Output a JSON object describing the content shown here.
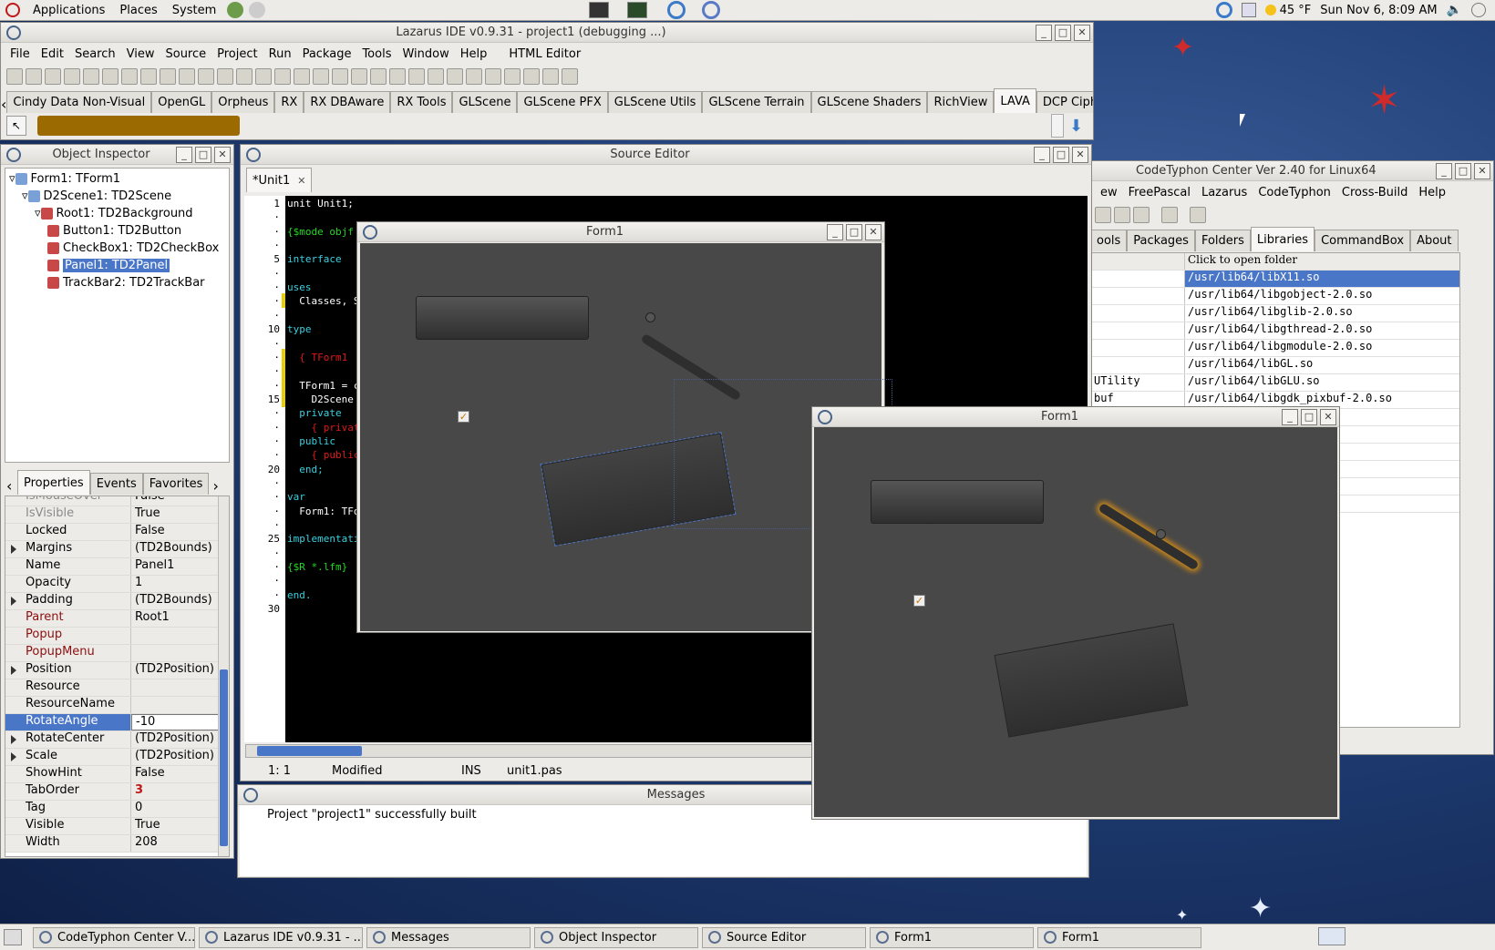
{
  "top_panel": {
    "menus": [
      "Applications",
      "Places",
      "System"
    ],
    "weather": "45 °F",
    "clock": "Sun Nov  6,  8:09 AM"
  },
  "lazarus": {
    "title": "Lazarus IDE v0.9.31 - project1 (debugging ...)",
    "menu": [
      "File",
      "Edit",
      "Search",
      "View",
      "Source",
      "Project",
      "Run",
      "Package",
      "Tools",
      "Window",
      "Help",
      "HTML Editor"
    ],
    "palette_tabs": [
      "Cindy Data Non-Visual",
      "OpenGL",
      "Orpheus",
      "RX",
      "RX DBAware",
      "RX Tools",
      "GLScene",
      "GLScene PFX",
      "GLScene Utils",
      "GLScene Terrain",
      "GLScene Shaders",
      "RichView",
      "LAVA",
      "DCP Ciphers"
    ],
    "active_palette_tab": "LAVA",
    "arch_badge": "64"
  },
  "object_inspector": {
    "title": "Object Inspector",
    "tree": [
      {
        "label": "Form1: TForm1",
        "level": 0
      },
      {
        "label": "D2Scene1: TD2Scene",
        "level": 1
      },
      {
        "label": "Root1: TD2Background",
        "level": 2
      },
      {
        "label": "Button1: TD2Button",
        "level": 3
      },
      {
        "label": "CheckBox1: TD2CheckBox",
        "level": 3
      },
      {
        "label": "Panel1: TD2Panel",
        "level": 3
      },
      {
        "label": "TrackBar2: TD2TrackBar",
        "level": 3
      }
    ],
    "selected_node": "Panel1: TD2Panel",
    "tabs": [
      "Properties",
      "Events",
      "Favorites"
    ],
    "properties": [
      {
        "name": "IsMouseOver",
        "value": "False"
      },
      {
        "name": "IsVisible",
        "value": "True"
      },
      {
        "name": "Locked",
        "value": "False"
      },
      {
        "name": "Margins",
        "value": "(TD2Bounds)"
      },
      {
        "name": "Name",
        "value": "Panel1"
      },
      {
        "name": "Opacity",
        "value": "1"
      },
      {
        "name": "Padding",
        "value": "(TD2Bounds)"
      },
      {
        "name": "Parent",
        "value": "Root1"
      },
      {
        "name": "Popup",
        "value": ""
      },
      {
        "name": "PopupMenu",
        "value": ""
      },
      {
        "name": "Position",
        "value": "(TD2Position)"
      },
      {
        "name": "Resource",
        "value": ""
      },
      {
        "name": "ResourceName",
        "value": ""
      },
      {
        "name": "RotateAngle",
        "value": "-10"
      },
      {
        "name": "RotateCenter",
        "value": "(TD2Position)"
      },
      {
        "name": "Scale",
        "value": "(TD2Position)"
      },
      {
        "name": "ShowHint",
        "value": "False"
      },
      {
        "name": "TabOrder",
        "value": "3"
      },
      {
        "name": "Tag",
        "value": "0"
      },
      {
        "name": "Visible",
        "value": "True"
      },
      {
        "name": "Width",
        "value": "208"
      }
    ]
  },
  "source_editor": {
    "title": "Source Editor",
    "tab": "*Unit1",
    "gutter": [
      "1",
      "·",
      "·",
      "·",
      "5",
      "·",
      "·",
      "·",
      "·",
      "10",
      "·",
      "·",
      "·",
      "·",
      "15",
      "·",
      "·",
      "·",
      "·",
      "20",
      "·",
      "·",
      "·",
      "·",
      "25",
      "·",
      "·",
      "·",
      "·",
      "30"
    ],
    "lines": [
      {
        "t": "unit Unit1;",
        "c": "#ffffff"
      },
      {
        "t": "",
        "c": "#ffffff"
      },
      {
        "t": "{$mode objf",
        "c": "#22d822"
      },
      {
        "t": "",
        "c": "#ffffff"
      },
      {
        "t": "interface",
        "c": "#3ad0e0"
      },
      {
        "t": "",
        "c": "#ffffff"
      },
      {
        "t": "uses",
        "c": "#3ad0e0"
      },
      {
        "t": "  Classes, S",
        "c": "#ffffff"
      },
      {
        "t": "",
        "c": "#ffffff"
      },
      {
        "t": "type",
        "c": "#3ad0e0"
      },
      {
        "t": "",
        "c": "#ffffff"
      },
      {
        "t": "  { TForm1",
        "c": "#e01818"
      },
      {
        "t": "",
        "c": "#ffffff"
      },
      {
        "t": "  TForm1 = c",
        "c": "#ffffff"
      },
      {
        "t": "    D2Scene",
        "c": "#ffffff"
      },
      {
        "t": "  private",
        "c": "#3ad0e0"
      },
      {
        "t": "    { privat",
        "c": "#e01818"
      },
      {
        "t": "  public",
        "c": "#3ad0e0"
      },
      {
        "t": "    { public",
        "c": "#e01818"
      },
      {
        "t": "  end;",
        "c": "#3ad0e0"
      },
      {
        "t": "",
        "c": "#ffffff"
      },
      {
        "t": "var",
        "c": "#3ad0e0"
      },
      {
        "t": "  Form1: TFo",
        "c": "#ffffff"
      },
      {
        "t": "",
        "c": "#ffffff"
      },
      {
        "t": "implementati",
        "c": "#3ad0e0"
      },
      {
        "t": "",
        "c": "#ffffff"
      },
      {
        "t": "{$R *.lfm}",
        "c": "#22d822"
      },
      {
        "t": "",
        "c": "#ffffff"
      },
      {
        "t": "end.",
        "c": "#3ad0e0"
      },
      {
        "t": "",
        "c": "#ffffff"
      }
    ],
    "status": {
      "pos": "1:  1",
      "modified": "Modified",
      "mode": "INS",
      "file": "unit1.pas"
    }
  },
  "messages": {
    "title": "Messages",
    "text": "Project \"project1\" successfully built"
  },
  "form_design": {
    "title": "Form1"
  },
  "form_run": {
    "title": "Form1"
  },
  "codetyphon": {
    "title": "CodeTyphon Center Ver 2.40 for Linux64",
    "menu": [
      "ew",
      "FreePascal",
      "Lazarus",
      "CodeTyphon",
      "Cross-Build",
      "Help"
    ],
    "tabs": [
      "ools",
      "Packages",
      "Folders",
      "Libraries",
      "CommandBox",
      "About"
    ],
    "active_tab": "Libraries",
    "header": "Click to open folder",
    "rows": [
      {
        "k": "",
        "v": "/usr/lib64/libX11.so"
      },
      {
        "k": "",
        "v": "/usr/lib64/libgobject-2.0.so"
      },
      {
        "k": "",
        "v": "/usr/lib64/libglib-2.0.so"
      },
      {
        "k": "",
        "v": "/usr/lib64/libgthread-2.0.so"
      },
      {
        "k": "",
        "v": "/usr/lib64/libgmodule-2.0.so"
      },
      {
        "k": "",
        "v": "/usr/lib64/libGL.so"
      },
      {
        "k": "UTility",
        "v": "/usr/lib64/libGLU.so"
      },
      {
        "k": "buf",
        "v": "/usr/lib64/libgdk_pixbuf-2.0.so"
      },
      {
        "k": "",
        "v": "2.0.so"
      },
      {
        "k": "",
        "v": "-x11-1.0.so"
      },
      {
        "k": "",
        "v": "-x11-1.0.so"
      },
      {
        "k": "",
        "v": ""
      },
      {
        "k": "",
        "v": "0.so"
      },
      {
        "k": "",
        "v": "ro-1.0.so"
      }
    ]
  },
  "taskbar": [
    "CodeTyphon Center V...",
    "Lazarus IDE v0.9.31 - ...",
    "Messages",
    "Object Inspector",
    "Source Editor",
    "Form1",
    "Form1"
  ]
}
